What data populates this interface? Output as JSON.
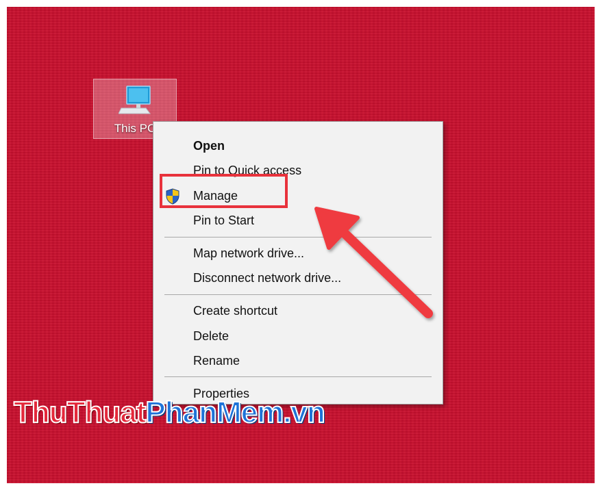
{
  "desktop": {
    "icon_label": "This PC",
    "background_color": "#c8102e"
  },
  "context_menu": {
    "items": [
      {
        "label": "Open",
        "bold": true
      },
      {
        "label": "Pin to Quick access"
      },
      {
        "label": "Manage",
        "icon": "uac-shield-icon"
      },
      {
        "label": "Pin to Start"
      },
      {
        "label": "Map network drive..."
      },
      {
        "label": "Disconnect network drive..."
      },
      {
        "label": "Create shortcut"
      },
      {
        "label": "Delete"
      },
      {
        "label": "Rename"
      },
      {
        "label": "Properties"
      }
    ]
  },
  "annotation": {
    "highlight_color": "#e8323c",
    "highlighted_item": "Manage",
    "arrow": "red-arrow-icon"
  },
  "watermark": {
    "part1": "ThuThuat",
    "part2": "PhanMem.vn",
    "color1": "#e4283a",
    "color2": "#1e73d8"
  }
}
